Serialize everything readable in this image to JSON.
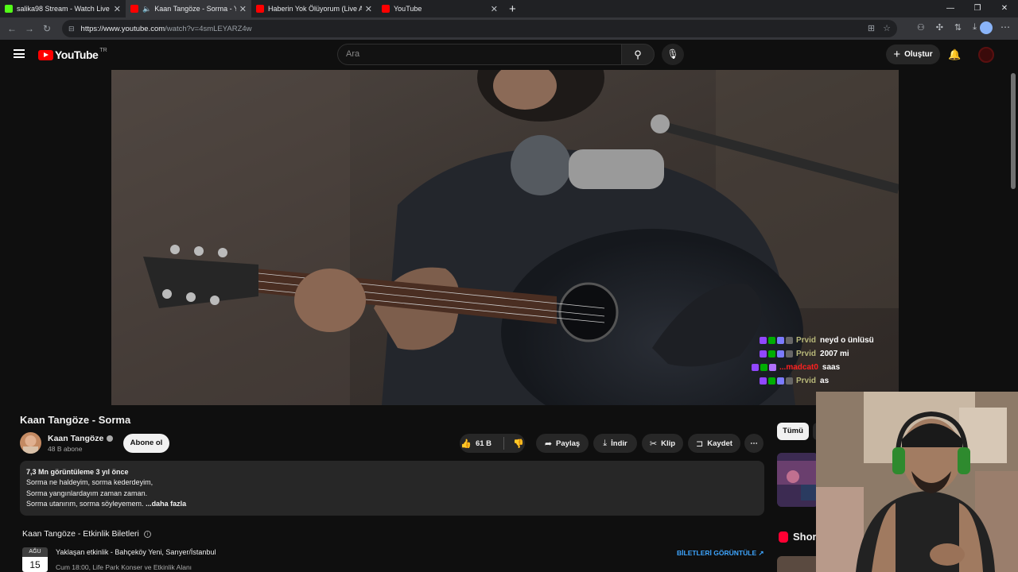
{
  "browser": {
    "tabs": [
      {
        "title": "salika98 Stream - Watch Live",
        "favicon_color": "#53fc18",
        "audio": true,
        "active": false
      },
      {
        "title": "Kaan Tangöze - Sorma - YouTube",
        "favicon_color": "#ff0000",
        "audio": true,
        "active": true
      },
      {
        "title": "Haberin Yok Ölüyorum (Live At Bo",
        "favicon_color": "#ff0000",
        "audio": false,
        "active": false
      },
      {
        "title": "YouTube",
        "favicon_color": "#ff0000",
        "audio": false,
        "active": false
      }
    ],
    "url_host": "https://www.youtube.com",
    "url_path": "/watch?v=4smLEYARZ4w"
  },
  "youtube": {
    "logo_text": "YouTube",
    "country_code": "TR",
    "search_placeholder": "Ara",
    "create_label": "Oluştur"
  },
  "chat": [
    {
      "name": "Prvid",
      "msg": "neyd o ünlüsü",
      "name_color": "#b9b97a"
    },
    {
      "name": "Prvid",
      "msg": "2007 mi",
      "name_color": "#b9b97a"
    },
    {
      "name": "...madcat0",
      "msg": "saas",
      "name_color": "#ff2020"
    },
    {
      "name": "Prvid",
      "msg": "as",
      "name_color": "#b9b97a"
    }
  ],
  "video": {
    "title": "Kaan Tangöze - Sorma",
    "channel": "Kaan Tangöze",
    "subscribers": "48 B abone",
    "subscribe_label": "Abone ol",
    "likes": "61 B",
    "share_label": "Paylaş",
    "download_label": "İndir",
    "clip_label": "Klip",
    "save_label": "Kaydet",
    "more_label": "⋯"
  },
  "description": {
    "meta": "7,3 Mn görüntüleme  3 yıl önce",
    "line1": "Sorma ne haldeyim, sorma kederdeyim,",
    "line2": "Sorma yangınlardayım zaman zaman.",
    "line3": "Sorma utanırım, sorma söyleyemem.",
    "more": "...daha fazla"
  },
  "events": {
    "title": "Kaan Tangöze - Etkinlik Biletleri",
    "month": "AĞU",
    "day": "15",
    "line1": "Yaklaşan etkinlik - Bahçeköy Yeni, Sarıyer/İstanbul",
    "line2": "Cum 18:00, Life Park Konser ve Etkinlik Alanı",
    "tickets_label": "BİLETLERİ GÖRÜNTÜLE"
  },
  "sidebar": {
    "chip_all": "Tümü",
    "shorts_label": "Shor"
  },
  "colors": {
    "youtube_red": "#ff0000",
    "link_blue": "#3ea6ff",
    "background": "#0f0f0f"
  }
}
